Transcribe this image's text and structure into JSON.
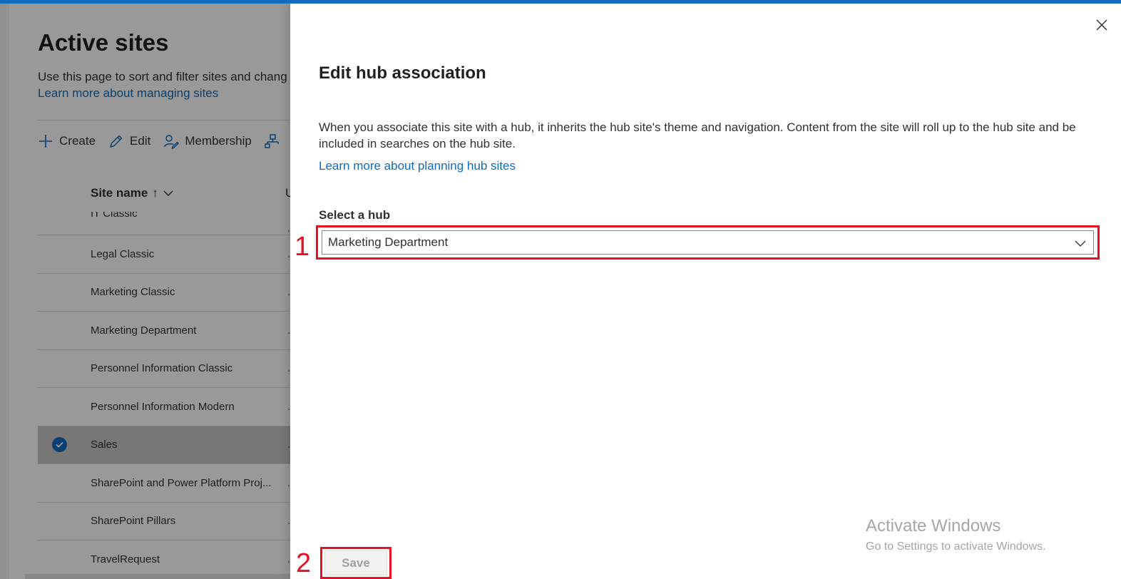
{
  "background": {
    "title": "Active sites",
    "description": "Use this page to sort and filter sites and chang",
    "learn_link": "Learn more about managing sites",
    "toolbar": {
      "create": "Create",
      "edit": "Edit",
      "membership": "Membership"
    },
    "columns": {
      "site_name": "Site name",
      "sort_arrow": "↑",
      "second_initial": "U"
    },
    "rows": [
      {
        "name": "IT Classic"
      },
      {
        "name": "Legal Classic"
      },
      {
        "name": "Marketing Classic"
      },
      {
        "name": "Marketing Department"
      },
      {
        "name": "Personnel Information Classic"
      },
      {
        "name": "Personnel Information Modern"
      },
      {
        "name": "Sales",
        "selected": true
      },
      {
        "name": "SharePoint and Power Platform Proj..."
      },
      {
        "name": "SharePoint Pillars"
      },
      {
        "name": "TravelRequest"
      }
    ],
    "row_trailing": "."
  },
  "panel": {
    "title": "Edit hub association",
    "description": "When you associate this site with a hub, it inherits the hub site's theme and navigation. Content from the site will roll up to the hub site and be included in searches on the hub site.",
    "learn_link": "Learn more about planning hub sites",
    "select_label": "Select a hub",
    "selected_hub": "Marketing Department",
    "save_label": "Save"
  },
  "annotations": {
    "step1": "1",
    "step2": "2"
  },
  "watermark": {
    "line1": "Activate Windows",
    "line2": "Go to Settings to activate Windows."
  },
  "colors": {
    "accent": "#0f6cbd",
    "annotation": "#e81123"
  }
}
